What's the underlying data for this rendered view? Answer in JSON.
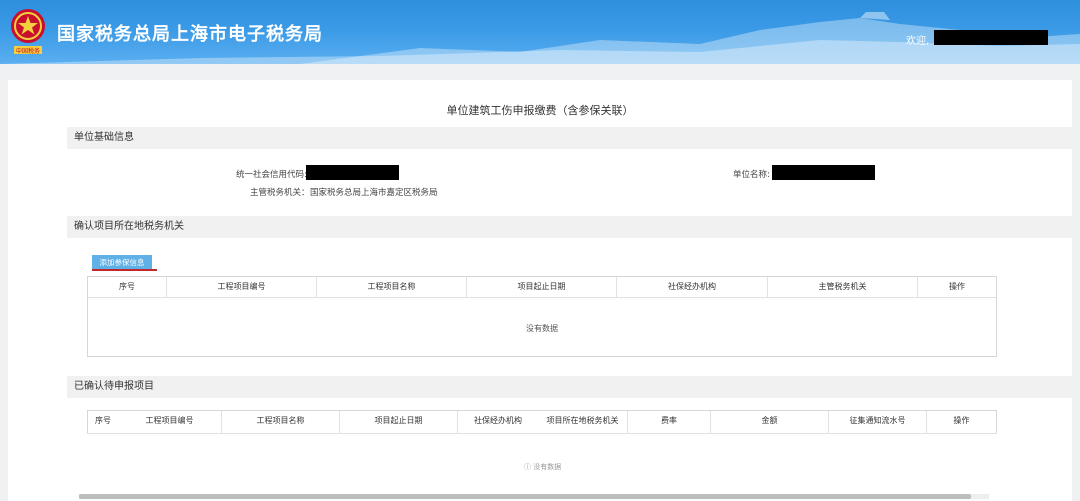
{
  "header": {
    "site_title": "国家税务总局上海市电子税务局",
    "welcome": "欢迎,",
    "emblem_text": "中国税务"
  },
  "page_title": "单位建筑工伤申报缴费（含参保关联）",
  "section_basic": {
    "title": "单位基础信息",
    "credit_code_label": "统一社会信用代码:",
    "unit_name_label": "单位名称:",
    "tax_authority_label": "主管税务机关：",
    "tax_authority_value": "国家税务总局上海市嘉定区税务局"
  },
  "section_confirm": {
    "title": "确认项目所在地税务机关",
    "add_button": "添加参保信息",
    "columns": [
      "序号",
      "工程项目编号",
      "工程项目名称",
      "项目起止日期",
      "社保经办机构",
      "主管税务机关",
      "操作"
    ],
    "empty_text": "没有数据"
  },
  "section_pending": {
    "title": "已确认待申报项目",
    "columns": [
      "序号",
      "工程项目编号",
      "工程项目名称",
      "项目起止日期",
      "社保经办机构",
      "项目所在地税务机关",
      "费率",
      "金额",
      "征集通知流水号",
      "操作"
    ],
    "empty_text": "没有数据"
  },
  "colors": {
    "header_blue": "#3a9ae6",
    "button_blue": "#5fb0e6",
    "underline_red": "#c0282d"
  }
}
